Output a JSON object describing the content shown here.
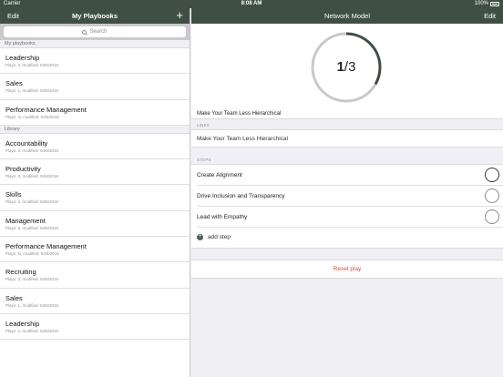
{
  "status": {
    "carrier": "Carrier",
    "time": "8:08 AM",
    "battery": "100%"
  },
  "left": {
    "edit_label": "Edit",
    "title": "My Playbooks",
    "add_label": "+",
    "search_placeholder": "Search",
    "my_section": "My playbooks",
    "my_items": [
      {
        "name": "Leadership",
        "meta": "Plays: 3, modified: 04/6/2016"
      },
      {
        "name": "Sales",
        "meta": "Plays: 1, modified: 04/6/2016"
      },
      {
        "name": "Performance Management",
        "meta": "Plays: N, modified: 04/6/2016"
      }
    ],
    "library_section": "Library",
    "library_items": [
      {
        "name": "Accountability",
        "meta": "Plays: 4, modified: 04/6/2016"
      },
      {
        "name": "Productivity",
        "meta": "Plays: 3, modified: 04/6/2016"
      },
      {
        "name": "Skills",
        "meta": "Plays: 2, modified: 04/6/2016"
      },
      {
        "name": "Management",
        "meta": "Plays: 5, modified: 04/6/2016"
      },
      {
        "name": "Performance Management",
        "meta": "Plays: N, modified: 04/6/2016"
      },
      {
        "name": "Recruiting",
        "meta": "Plays: 3, modified: 04/6/2016"
      },
      {
        "name": "Sales",
        "meta": "Plays: 1, modified: 04/6/2016"
      },
      {
        "name": "Leadership",
        "meta": "Plays: 2, modified: 04/6/2016"
      }
    ]
  },
  "right": {
    "title": "Network Model",
    "edit_label": "Edit",
    "progress": {
      "done": "1",
      "separator": "/",
      "total": "3",
      "fraction": 0.333
    },
    "play_name": "Make Your Team Less Hierarchical",
    "links_header": "LINKS",
    "link": "Make Your Team Less Hierarchical",
    "steps_header": "STEPS",
    "steps": [
      {
        "label": "Create Alignment"
      },
      {
        "label": "Drive Inclusion and Transparency"
      },
      {
        "label": "Lead with Empathy"
      }
    ],
    "add_step_label": "add step",
    "add_step_icon": "+",
    "reset_label": "Reset play"
  },
  "colors": {
    "navbar": "#3f4f44",
    "accent_red": "#e0463a",
    "ring_track": "#c8c8c8",
    "ring_progress": "#3f4f44"
  }
}
